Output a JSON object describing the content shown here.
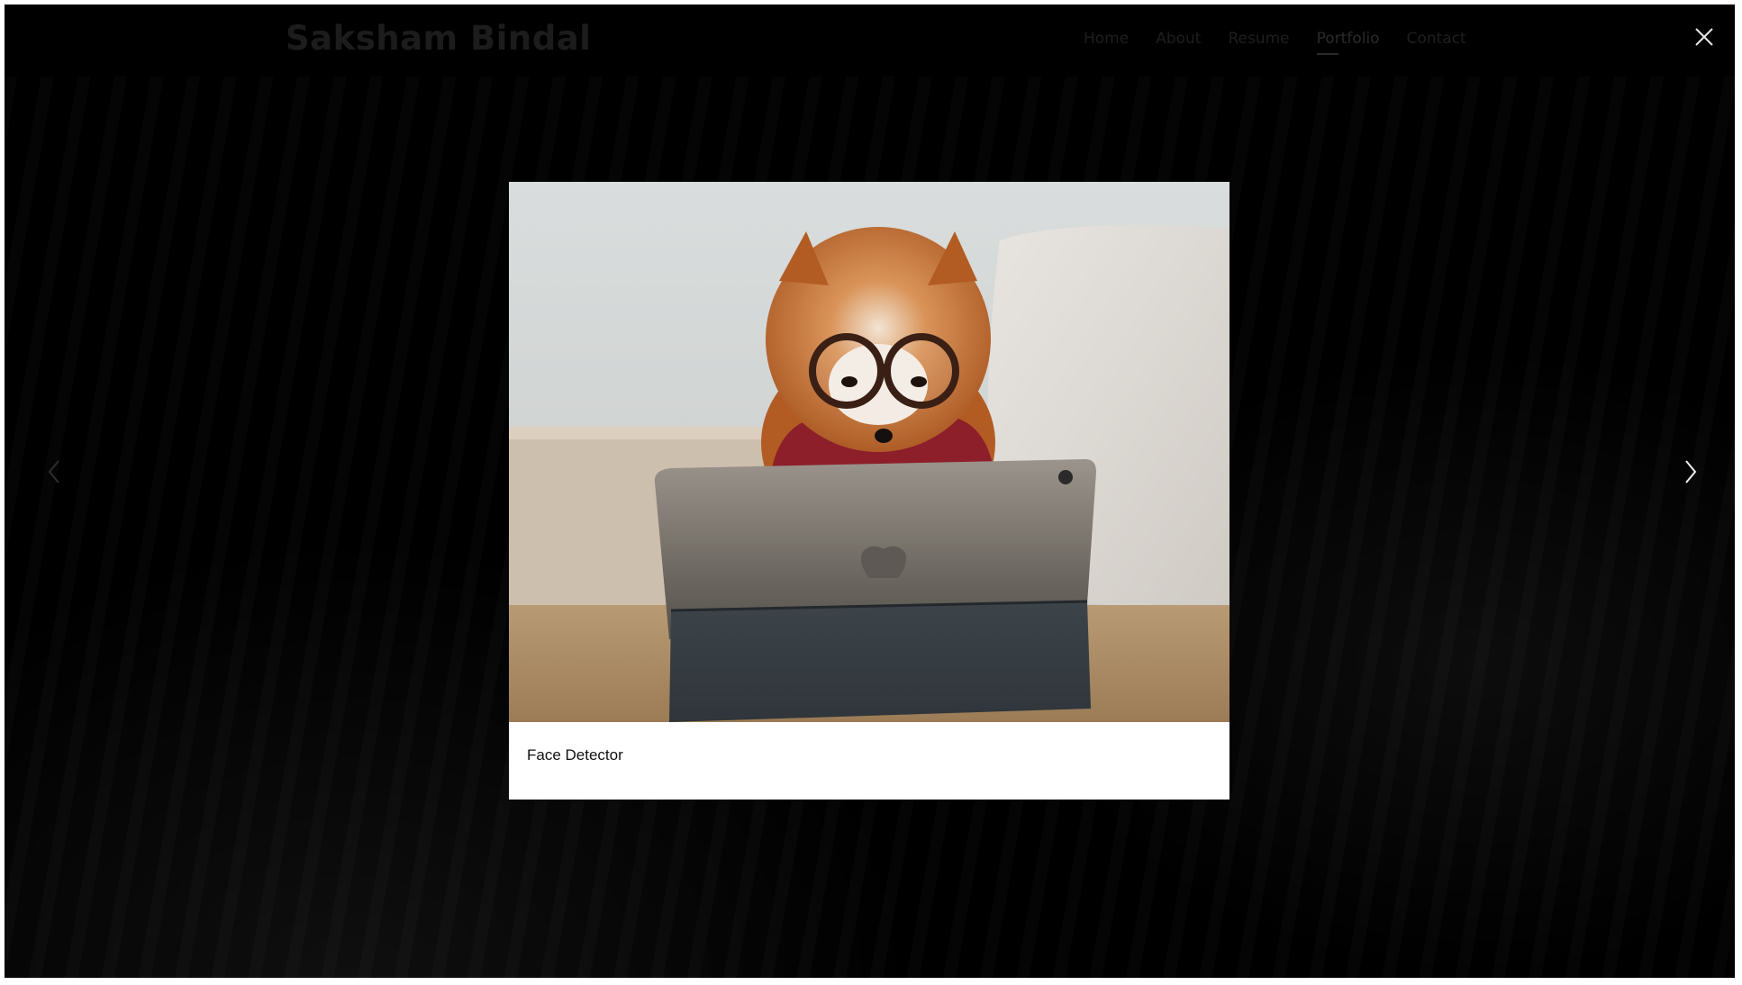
{
  "header": {
    "brand": "Saksham Bindal",
    "nav": [
      {
        "label": "Home",
        "active": false
      },
      {
        "label": "About",
        "active": false
      },
      {
        "label": "Resume",
        "active": false
      },
      {
        "label": "Portfolio",
        "active": true
      },
      {
        "label": "Contact",
        "active": false
      }
    ]
  },
  "lightbox": {
    "caption": "Face Detector",
    "image_icon": "pomeranian-with-glasses-and-tablet-photo"
  },
  "controls": {
    "close_icon": "close-icon",
    "prev_icon": "chevron-left-icon",
    "next_icon": "chevron-right-icon"
  },
  "colors": {
    "overlay": "#000000",
    "lightbox_bg": "#ffffff"
  }
}
